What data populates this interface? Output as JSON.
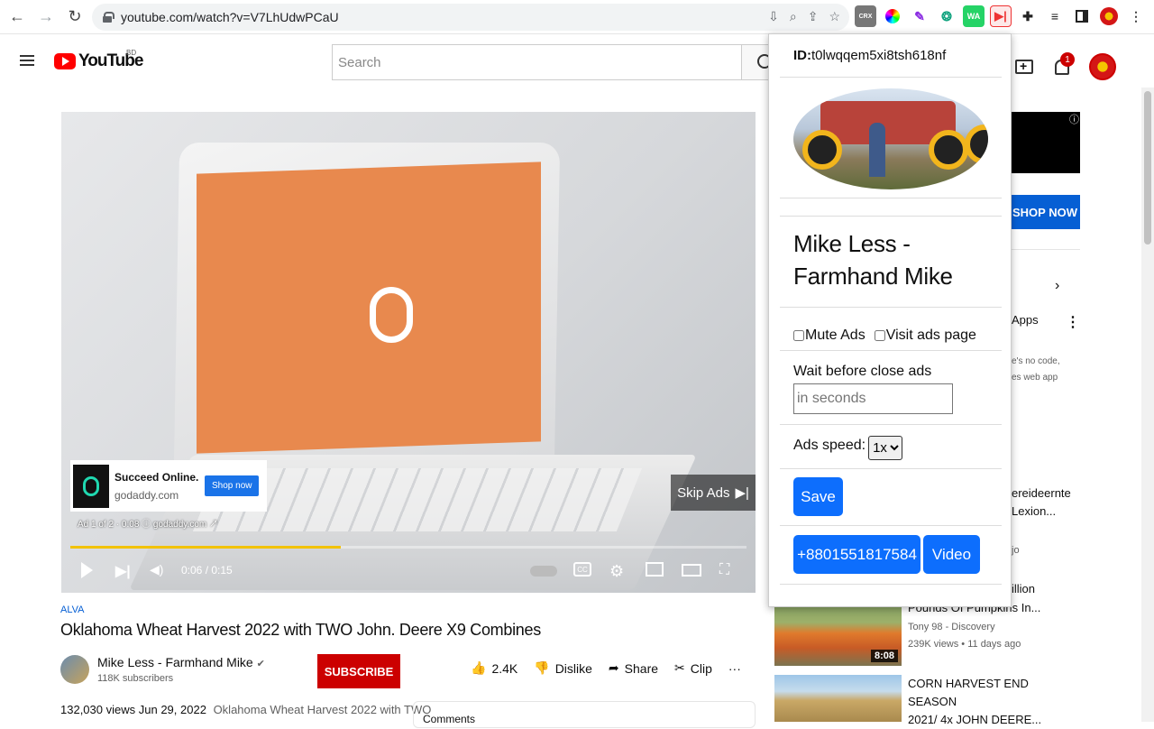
{
  "browser": {
    "url": "youtube.com/watch?v=V7LhUdwPCaU",
    "extensions": [
      "CRX",
      "color-picker",
      "pen",
      "openai",
      "WA",
      "ads-skipper",
      "puzzle",
      "media",
      "sidepanel",
      "profile"
    ]
  },
  "youtube": {
    "logo_text": "YouTube",
    "region": "BD",
    "search_placeholder": "Search",
    "notification_count": "1"
  },
  "player": {
    "ad_title": "Succeed Online.",
    "ad_domain": "godaddy.com",
    "ad_button": "Shop now",
    "ad_info": "Ad 1 of 2 · 0:08  ⓘ  godaddy.com ↗",
    "skip_label": "Skip Ads",
    "time": "0:06 / 0:15",
    "progress_fraction": 0.4,
    "cc_label": "CC"
  },
  "video": {
    "channel_tag": "ALVA",
    "title": "Oklahoma Wheat Harvest 2022 with TWO John. Deere X9 Combines",
    "channel_name": "Mike Less - Farmhand Mike",
    "subscribers": "118K subscribers",
    "subscribe_label": "SUBSCRIBE",
    "likes": "2.4K",
    "dislike_label": "Dislike",
    "share_label": "Share",
    "clip_label": "Clip",
    "more_label": "···",
    "views": "132,030 views",
    "date": "Jun 29, 2022",
    "description_preview": "Oklahoma Wheat Harvest 2022 with TWO",
    "comments_label": "Comments"
  },
  "sidebar": {
    "shop_now": "SHOP NOW",
    "ad_info_icon": "ⓘ",
    "chip_apps": "Apps",
    "small_text_1": "e's no code,",
    "small_text_2": "es web app",
    "partial_1": "ereideernte",
    "partial_2": "Lexion...",
    "partial_3": "jo",
    "rec_partial_title": "illion",
    "recs": [
      {
        "title_line2": "Pounds Of Pumpkins In...",
        "channel": "Tony 98 - Discovery",
        "meta": "239K views • 11 days ago",
        "duration": "8:08"
      },
      {
        "title_line1": "CORN HARVEST END SEASON",
        "title_line2": "2021/ 4x JOHN DEERE..."
      }
    ]
  },
  "popup": {
    "id_label": "ID:",
    "id_value": "t0lwqqem5xi8tsh618nf",
    "channel_line1": "Mike Less -",
    "channel_line2": "Farmhand Mike",
    "mute_label": "Mute Ads",
    "visit_label": "Visit ads page",
    "wait_label": "Wait before close ads",
    "wait_placeholder": "in seconds",
    "speed_label": "Ads speed:",
    "speed_value": "1x",
    "save_label": "Save",
    "phone_label": "+8801551817584",
    "video_label": "Video"
  },
  "colors": {
    "youtube_red": "#ff0000",
    "subscribe_red": "#cc0000",
    "popup_button_blue": "#0d6efd",
    "ad_screen_orange": "#e8894e",
    "progress_yellow": "#f2c200"
  }
}
